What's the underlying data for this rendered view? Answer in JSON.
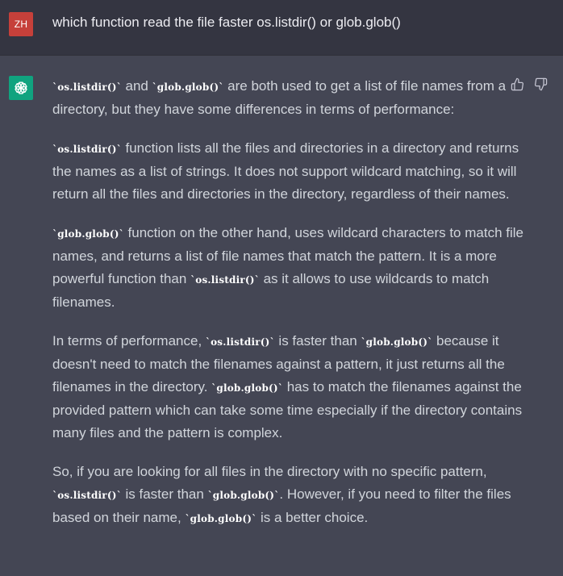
{
  "user": {
    "avatar_text": "ZH",
    "avatar_color": "#c6403a",
    "message": "which function read the file faster os.listdir() or glob.glob()"
  },
  "assistant": {
    "avatar_icon": "openai-logo-icon",
    "avatar_color": "#10a37f",
    "feedback_icons": [
      "thumbs-up-icon",
      "thumbs-down-icon"
    ],
    "paragraphs": [
      [
        {
          "type": "code",
          "text": "`os.listdir()`"
        },
        {
          "type": "text",
          "text": " and "
        },
        {
          "type": "code",
          "text": "`glob.glob()`"
        },
        {
          "type": "text",
          "text": " are both used to get a list of file names from a directory, but they have some differences in terms of performance:"
        }
      ],
      [
        {
          "type": "code",
          "text": "`os.listdir()`"
        },
        {
          "type": "text",
          "text": " function lists all the files and directories in a directory and returns the names as a list of strings. It does not support wildcard matching, so it will return all the files and directories in the directory, regardless of their names."
        }
      ],
      [
        {
          "type": "code",
          "text": "`glob.glob()`"
        },
        {
          "type": "text",
          "text": " function on the other hand, uses wildcard characters to match file names, and returns a list of file names that match the pattern. It is a more powerful function than "
        },
        {
          "type": "code",
          "text": "`os.listdir()`"
        },
        {
          "type": "text",
          "text": " as it allows to use wildcards to match filenames."
        }
      ],
      [
        {
          "type": "text",
          "text": "In terms of performance, "
        },
        {
          "type": "code",
          "text": "`os.listdir()`"
        },
        {
          "type": "text",
          "text": " is faster than "
        },
        {
          "type": "code",
          "text": "`glob.glob()`"
        },
        {
          "type": "text",
          "text": " because it doesn't need to match the filenames against a pattern, it just returns all the filenames in the directory. "
        },
        {
          "type": "code",
          "text": "`glob.glob()`"
        },
        {
          "type": "text",
          "text": " has to match the filenames against the provided pattern which can take some time especially if the directory contains many files and the pattern is complex."
        }
      ],
      [
        {
          "type": "text",
          "text": "So, if you are looking for all files in the directory with no specific pattern, "
        },
        {
          "type": "code",
          "text": "`os.listdir()`"
        },
        {
          "type": "text",
          "text": " is faster than "
        },
        {
          "type": "code",
          "text": "`glob.glob()`"
        },
        {
          "type": "text",
          "text": ". However, if you need to filter the files based on their name, "
        },
        {
          "type": "code",
          "text": "`glob.glob()`"
        },
        {
          "type": "text",
          "text": " is a better choice."
        }
      ]
    ]
  }
}
